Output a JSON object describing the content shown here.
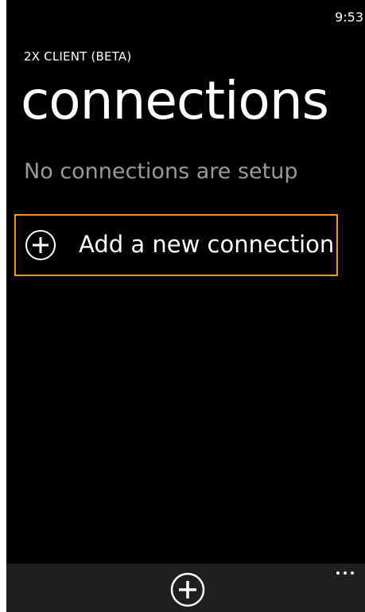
{
  "status_bar": {
    "time": "9:53"
  },
  "header": {
    "app_title": "2X CLIENT (BETA)",
    "page_title": "connections"
  },
  "main": {
    "empty_message": "No connections are setup",
    "add_item": {
      "label": "Add a new connection",
      "icon": "add-circle-icon"
    }
  },
  "app_bar": {
    "buttons": [
      {
        "icon": "add-circle-icon"
      }
    ],
    "more_icon": "ellipsis-icon"
  },
  "colors": {
    "background": "#000000",
    "accent": "#f0961e",
    "text_primary": "#ffffff",
    "text_secondary": "#9a9a9a",
    "app_bar": "#1f1f1f"
  }
}
